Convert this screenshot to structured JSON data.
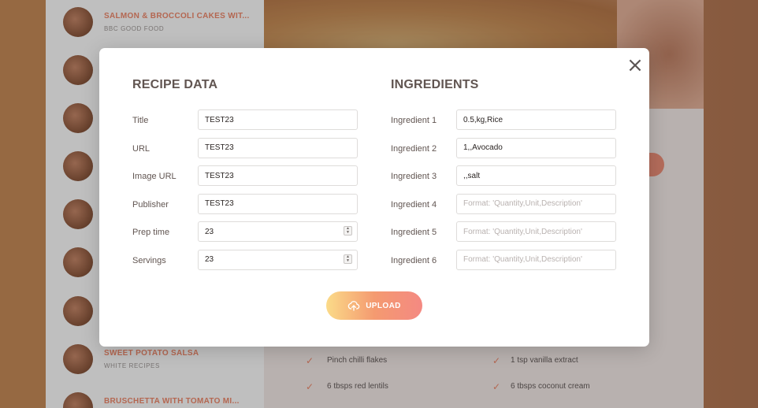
{
  "background": {
    "sidebar_items": [
      {
        "title": "SALMON & BROCCOLI CAKES WIT...",
        "sub": "BBC GOOD FOOD"
      },
      {
        "title": "",
        "sub": ""
      },
      {
        "title": "",
        "sub": ""
      },
      {
        "title": "",
        "sub": ""
      },
      {
        "title": "",
        "sub": ""
      },
      {
        "title": "",
        "sub": ""
      },
      {
        "title": "",
        "sub": ""
      },
      {
        "title": "SWEET POTATO SALSA",
        "sub": "WHITE RECIPES"
      },
      {
        "title": "BRUSCHETTA WITH TOMATO MI...",
        "sub": ""
      }
    ],
    "ingredients": [
      "Pinch chilli flakes",
      "1 tsp vanilla extract",
      "6 tbsps red lentils",
      "6 tbsps coconut cream"
    ]
  },
  "modal": {
    "close_symbol": "×",
    "recipe": {
      "heading": "RECIPE DATA",
      "fields": [
        {
          "label": "Title",
          "value": "TEST23",
          "type": "text"
        },
        {
          "label": "URL",
          "value": "TEST23",
          "type": "text"
        },
        {
          "label": "Image URL",
          "value": "TEST23",
          "type": "text"
        },
        {
          "label": "Publisher",
          "value": "TEST23",
          "type": "text"
        },
        {
          "label": "Prep time",
          "value": "23",
          "type": "number"
        },
        {
          "label": "Servings",
          "value": "23",
          "type": "number"
        }
      ]
    },
    "ingredients": {
      "heading": "INGREDIENTS",
      "placeholder": "Format: 'Quantity,Unit,Description'",
      "fields": [
        {
          "label": "Ingredient 1",
          "value": "0.5,kg,Rice"
        },
        {
          "label": "Ingredient 2",
          "value": "1,,Avocado"
        },
        {
          "label": "Ingredient 3",
          "value": ",,salt"
        },
        {
          "label": "Ingredient 4",
          "value": ""
        },
        {
          "label": "Ingredient 5",
          "value": ""
        },
        {
          "label": "Ingredient 6",
          "value": ""
        }
      ]
    },
    "upload": {
      "label": "UPLOAD",
      "icon": "cloud-upload-icon"
    }
  },
  "colors": {
    "accent_start": "#fbdb89",
    "accent_end": "#f48982",
    "text": "#615551"
  }
}
